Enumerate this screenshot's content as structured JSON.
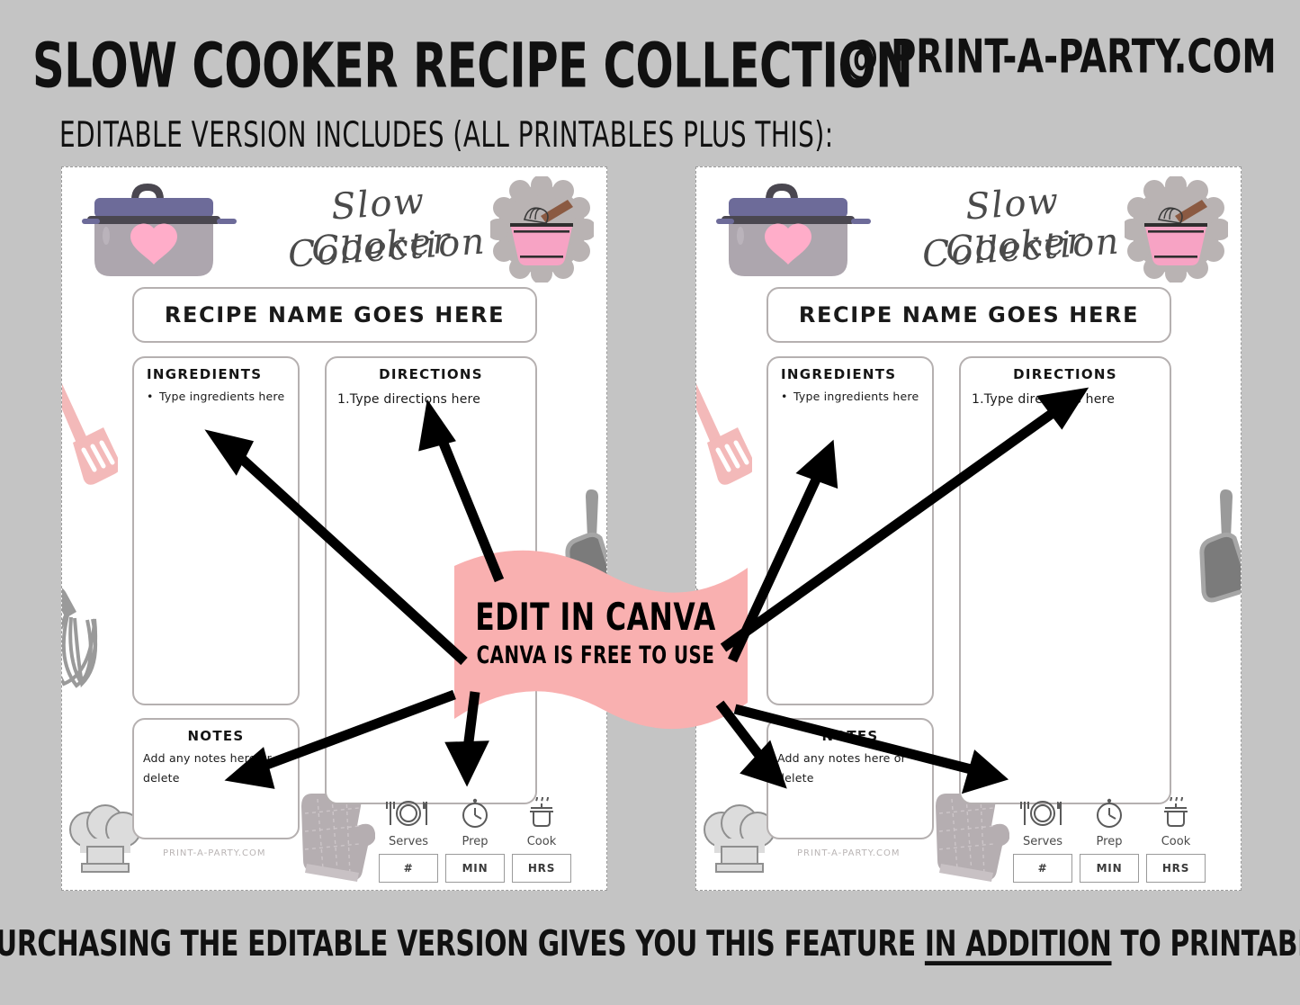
{
  "header": {
    "main_title": "SLOW COOKER RECIPE COLLECTION",
    "brand": "@ PRINT-A-PARTY.COM",
    "subtitle": "EDITABLE VERSION INCLUDES (ALL PRINTABLES PLUS THIS):"
  },
  "footer": {
    "before": "**PURCHASING THE EDITABLE VERSION GIVES YOU THIS FEATURE ",
    "underlined": "IN ADDITION",
    "after": " TO PRINTABLES"
  },
  "banner": {
    "line1": "EDIT IN CANVA",
    "line2": "CANVA IS FREE TO USE",
    "color": "#f9b0b0"
  },
  "card": {
    "logo_line1": "Slow Cooker",
    "logo_line2": "Collection",
    "recipe_name_placeholder": "RECIPE NAME GOES HERE",
    "ingredients_title": "INGREDIENTS",
    "ingredients_placeholder": "Type ingredients here",
    "directions_title": "DIRECTIONS",
    "directions_placeholder": "1.Type directions here",
    "notes_title": "NOTES",
    "notes_placeholder": "Add any notes here or delete",
    "watermark": "PRINT-A-PARTY.COM",
    "meta": [
      {
        "label": "Serves",
        "field": "#",
        "icon": "plate-cutlery-icon"
      },
      {
        "label": "Prep",
        "field": "MIN",
        "icon": "stopwatch-icon"
      },
      {
        "label": "Cook",
        "field": "HRS",
        "icon": "pot-steam-icon"
      }
    ]
  },
  "colors": {
    "background": "#c4c4c4",
    "card_background": "#ffffff",
    "pot_body": "#ada6ae",
    "pot_lid": "#6d6b99",
    "heart_pink": "#ffadc9",
    "bowl_pink": "#f7a3c4",
    "badge_gray": "#b9b3b3",
    "spatula_pink": "#f3b9b9",
    "utensil_gray": "#9a9a9a",
    "banner_pink": "#f9b0b0",
    "border_gray": "#b5b0b0"
  }
}
